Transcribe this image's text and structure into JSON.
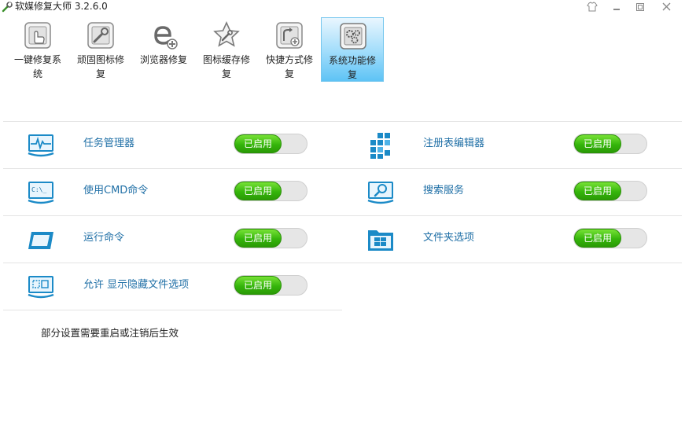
{
  "window": {
    "title": "软媒修复大师 3.2.6.0",
    "icon": "wrench-icon",
    "controls": [
      "skin-icon",
      "minimize-icon",
      "maximize-icon",
      "close-icon"
    ]
  },
  "toolbar": {
    "items": [
      {
        "label": "一键修复系统",
        "icon": "one-click-repair-icon"
      },
      {
        "label": "顽固图标修复",
        "icon": "stubborn-icon-repair-icon"
      },
      {
        "label": "浏览器修复",
        "icon": "browser-repair-icon"
      },
      {
        "label": "图标缓存修复",
        "icon": "icon-cache-repair-icon"
      },
      {
        "label": "快捷方式修复",
        "icon": "shortcut-repair-icon"
      },
      {
        "label": "系统功能修复",
        "icon": "system-function-repair-icon",
        "active": true
      }
    ]
  },
  "features": [
    {
      "label": "任务管理器",
      "toggle": "已启用",
      "icon": "task-manager-icon"
    },
    {
      "label": "注册表编辑器",
      "toggle": "已启用",
      "icon": "registry-editor-icon"
    },
    {
      "label": "使用CMD命令",
      "toggle": "已启用",
      "icon": "cmd-icon"
    },
    {
      "label": "搜索服务",
      "toggle": "已启用",
      "icon": "search-service-icon"
    },
    {
      "label": "运行命令",
      "toggle": "已启用",
      "icon": "run-command-icon"
    },
    {
      "label": "文件夹选项",
      "toggle": "已启用",
      "icon": "folder-options-icon"
    },
    {
      "label": "允许 显示隐藏文件选项",
      "toggle": "已启用",
      "icon": "hidden-files-icon"
    }
  ],
  "note": "部分设置需要重启或注销后生效",
  "colors": {
    "accent": "#1f8fd0",
    "toggle_on": "#3dbb12",
    "toggle_track": "#e6e6e6",
    "active_tab": "#7fd0f8"
  }
}
